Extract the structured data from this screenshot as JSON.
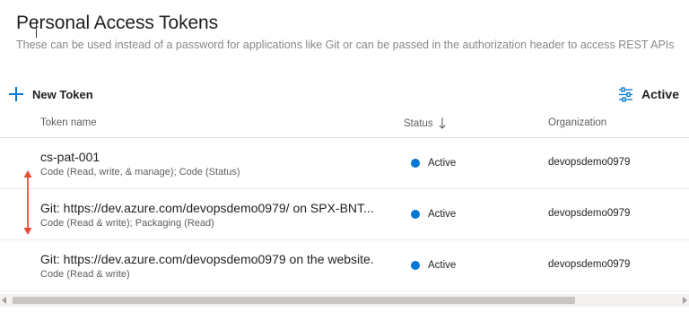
{
  "header": {
    "title": "Personal Access Tokens",
    "description": "These can be used instead of a password for applications like Git or can be passed in the authorization header to access REST APIs"
  },
  "toolbar": {
    "new_token_label": "New Token",
    "new_token_icon": "plus-icon",
    "filter_label": "Active",
    "filter_icon": "filter-sliders-icon"
  },
  "table": {
    "columns": {
      "name": "Token name",
      "status": "Status",
      "organization": "Organization"
    },
    "sort_direction": "descending",
    "rows": [
      {
        "name": "cs-pat-001",
        "scope": "Code (Read, write, & manage); Code (Status)",
        "status": "Active",
        "organization": "devopsdemo0979"
      },
      {
        "name": "Git: https://dev.azure.com/devopsdemo0979/ on SPX-BNT...",
        "scope": "Code (Read & write); Packaging (Read)",
        "status": "Active",
        "organization": "devopsdemo0979"
      },
      {
        "name": "Git: https://dev.azure.com/devopsdemo0979 on the website.",
        "scope": "Code (Read & write)",
        "status": "Active",
        "organization": "devopsdemo0979"
      }
    ]
  },
  "colors": {
    "accent": "#0078d4",
    "status_active": "#0078d4",
    "annotation_arrow": "#e74c3c"
  }
}
